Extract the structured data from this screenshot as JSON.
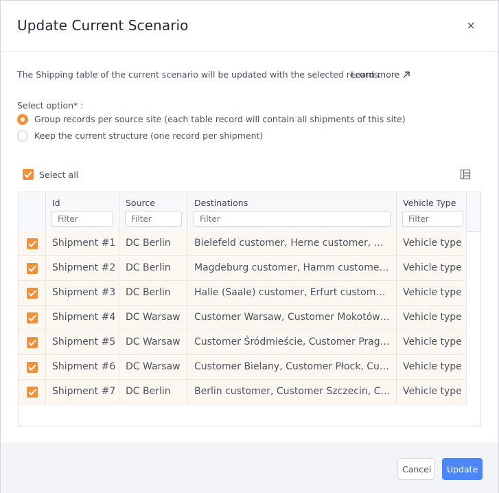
{
  "dialog": {
    "title": "Update Current Scenario",
    "close_label": "×",
    "intro": "The Shipping table of the current scenario will be updated with the selected records.",
    "learn_more": "Learn more",
    "option_label": "Select option* :",
    "options": [
      {
        "label": "Group records per source site (each table record will contain all shipments of this site)",
        "selected": true
      },
      {
        "label": "Keep the current structure (one record per shipment)",
        "selected": false
      }
    ],
    "select_all": {
      "label": "Select all",
      "checked": true
    }
  },
  "table": {
    "columns": [
      {
        "label": "Id",
        "filter_placeholder": "Filter"
      },
      {
        "label": "Source",
        "filter_placeholder": "Filter"
      },
      {
        "label": "Destinations",
        "filter_placeholder": "Filter"
      },
      {
        "label": "Vehicle Type",
        "filter_placeholder": "Filter"
      }
    ],
    "rows": [
      {
        "checked": true,
        "id": "Shipment #1",
        "source": "DC Berlin",
        "destinations": "Bielefeld customer, Herne customer, Gelsenkirchen customer",
        "vehicle": "Vehicle type"
      },
      {
        "checked": true,
        "id": "Shipment #2",
        "source": "DC Berlin",
        "destinations": "Magdeburg customer, Hamm customer, Mülheim customer",
        "vehicle": "Vehicle type"
      },
      {
        "checked": true,
        "id": "Shipment #3",
        "source": "DC Berlin",
        "destinations": "Halle (Saale) customer, Erfurt customer, Kassel customer",
        "vehicle": "Vehicle type"
      },
      {
        "checked": true,
        "id": "Shipment #4",
        "source": "DC Warsaw",
        "destinations": "Customer Warsaw, Customer Mokotów, Customer Wola",
        "vehicle": "Vehicle type"
      },
      {
        "checked": true,
        "id": "Shipment #5",
        "source": "DC Warsaw",
        "destinations": "Customer Śródmieście, Customer Praga Północ",
        "vehicle": "Vehicle type"
      },
      {
        "checked": true,
        "id": "Shipment #6",
        "source": "DC Warsaw",
        "destinations": "Customer Bielany, Customer Płock, Customer Radom",
        "vehicle": "Vehicle type"
      },
      {
        "checked": true,
        "id": "Shipment #7",
        "source": "DC Berlin",
        "destinations": "Berlin customer, Customer Szczecin, Customer Poznań",
        "vehicle": "Vehicle type"
      }
    ]
  },
  "footer": {
    "cancel_label": "Cancel",
    "update_label": "Update"
  },
  "colors": {
    "accent": "#f0913a",
    "primary": "#4d87f5",
    "row_bg": "#fdf7f1"
  },
  "icons": {
    "close": "close-icon",
    "external": "external-link-icon",
    "columns": "columns-icon",
    "check": "checkmark-icon"
  }
}
